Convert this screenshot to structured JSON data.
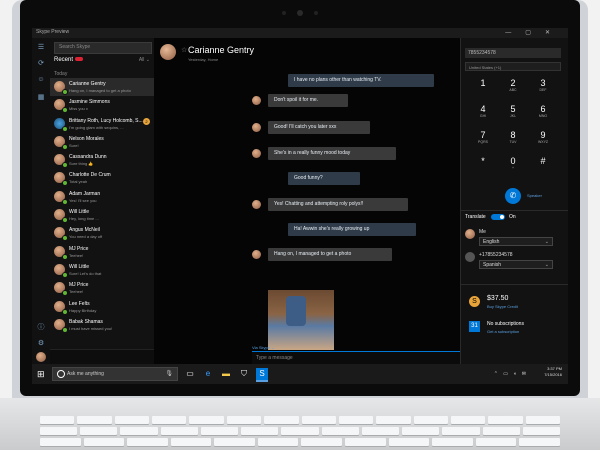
{
  "window": {
    "title": "Skype Preview",
    "controls": [
      "—",
      "▢",
      "✕"
    ]
  },
  "contacts_panel": {
    "search_placeholder": "Search Skype",
    "recent_label": "Recent",
    "filter_label": "All ⌄",
    "today_label": "Today",
    "contacts": [
      {
        "name": "Carianne Gentry",
        "message": "Hang on, I managed to get a photo",
        "selected": true
      },
      {
        "name": "Jasmine Simmons",
        "message": "Miss you x",
        "selected": false
      },
      {
        "name": "Brittany Roth, Lucy Holcomb, S...",
        "message": "I'm going glam with sequins, ...",
        "badge": "2",
        "group": true,
        "selected": false
      },
      {
        "name": "Nelson Morales",
        "message": "Sure!",
        "selected": false
      },
      {
        "name": "Cassandra Dunn",
        "message": "Sure thing 👍",
        "selected": false
      },
      {
        "name": "Charlotte De Crum",
        "message": "Total yeah",
        "selected": false
      },
      {
        "name": "Adam Jarman",
        "message": "Yes! I'll see you",
        "selected": false
      },
      {
        "name": "Will Little",
        "message": "Hey, long time ...",
        "selected": false
      },
      {
        "name": "Angus McNeil",
        "message": "You need a day off",
        "selected": false
      },
      {
        "name": "MJ Price",
        "message": "Teehee!",
        "selected": false
      },
      {
        "name": "Will Little",
        "message": "Sure! Let's do that",
        "selected": false
      },
      {
        "name": "MJ Price",
        "message": "Teehee!",
        "selected": false
      },
      {
        "name": "Lee Felts",
        "message": "Happy Birthday",
        "selected": false
      },
      {
        "name": "Babak Shamas",
        "message": "I must have missed you!",
        "selected": false
      }
    ]
  },
  "conversation": {
    "name": "Carianne Gentry",
    "status": "Yesterday, Home",
    "messages": [
      {
        "text": "I have no plans other than watching TV.",
        "direction": "out"
      },
      {
        "text": "Don't spoil it for me.",
        "direction": "in"
      },
      {
        "text": "Good! I'll catch you later xxx",
        "direction": "in"
      },
      {
        "text": "She's in a really funny mood today",
        "direction": "in"
      },
      {
        "text": "Good funny?",
        "direction": "out"
      },
      {
        "text": "Yes! Chatting and attempting roly polys!!",
        "direction": "in"
      },
      {
        "text": "Ha! Awwin she's really growing up",
        "direction": "out"
      },
      {
        "text": "Hang on, I managed to get a photo",
        "direction": "in"
      }
    ],
    "via_label": "Via Skype ⌄",
    "composer_placeholder": "Type a message"
  },
  "dialer": {
    "phone_number": "7855234578",
    "country": "United States (+1)",
    "keys": [
      {
        "digit": "1",
        "letters": ""
      },
      {
        "digit": "2",
        "letters": "ABC"
      },
      {
        "digit": "3",
        "letters": "DEF"
      },
      {
        "digit": "4",
        "letters": "GHI"
      },
      {
        "digit": "5",
        "letters": "JKL"
      },
      {
        "digit": "6",
        "letters": "MNO"
      },
      {
        "digit": "7",
        "letters": "PQRS"
      },
      {
        "digit": "8",
        "letters": "TUV"
      },
      {
        "digit": "9",
        "letters": "WXYZ"
      },
      {
        "digit": "*",
        "letters": ""
      },
      {
        "digit": "0",
        "letters": "+"
      },
      {
        "digit": "#",
        "letters": ""
      }
    ],
    "speaker_label": "Speaker"
  },
  "translate": {
    "label": "Translate",
    "toggle_state": "On",
    "me_label": "Me",
    "me_language": "English",
    "other_number": "+17855234578",
    "other_language": "Spanish"
  },
  "account": {
    "credit": "$37.50",
    "credit_link": "Buy Skype Credit",
    "subscriptions": "No subscriptions",
    "subscriptions_link": "Get a subscription"
  },
  "taskbar": {
    "cortana_placeholder": "Ask me anything",
    "time": "3:37 PM",
    "date": "7/15/2016"
  }
}
